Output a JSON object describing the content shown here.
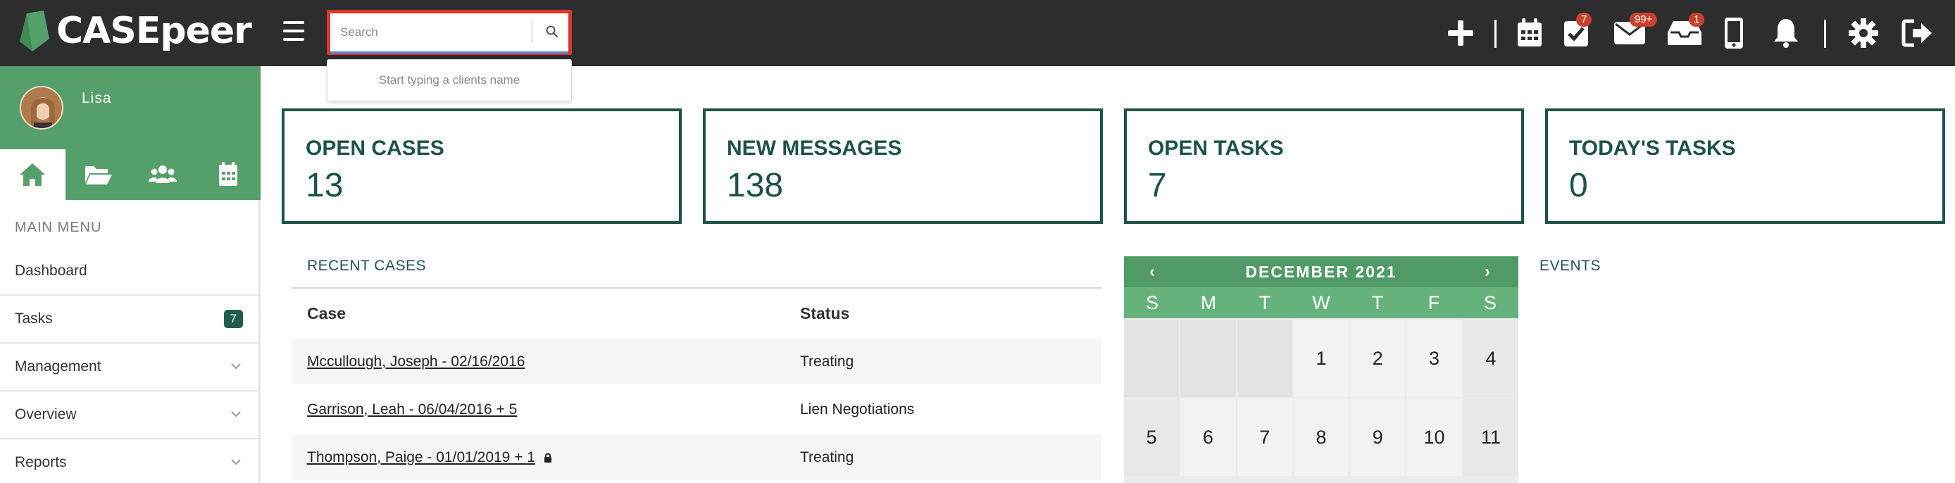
{
  "brand": {
    "name": "CASEpeer"
  },
  "search": {
    "placeholder": "Search",
    "hint": "Start typing a clients name"
  },
  "topbar": {
    "tasks_badge": "7",
    "messages_badge": "99+",
    "inbox_badge": "1"
  },
  "user": {
    "name": "Lisa"
  },
  "sidebar": {
    "menu_label": "MAIN MENU",
    "items": [
      {
        "label": "Dashboard"
      },
      {
        "label": "Tasks",
        "count": "7"
      },
      {
        "label": "Management"
      },
      {
        "label": "Overview"
      },
      {
        "label": "Reports"
      }
    ]
  },
  "stats": [
    {
      "label": "OPEN CASES",
      "value": "13"
    },
    {
      "label": "NEW MESSAGES",
      "value": "138"
    },
    {
      "label": "OPEN TASKS",
      "value": "7"
    },
    {
      "label": "TODAY'S TASKS",
      "value": "0"
    }
  ],
  "recent_cases": {
    "title": "RECENT CASES",
    "headers": {
      "case": "Case",
      "status": "Status"
    },
    "rows": [
      {
        "case": "Mccullough, Joseph - 02/16/2016",
        "status": "Treating"
      },
      {
        "case": "Garrison, Leah - 06/04/2016 + 5",
        "status": "Lien Negotiations"
      },
      {
        "case": "Thompson, Paige - 01/01/2019 + 1",
        "status": "Treating",
        "locked": true
      }
    ]
  },
  "calendar": {
    "title": "DECEMBER 2021",
    "prev": "‹",
    "next": "›",
    "days_of_week": [
      "S",
      "M",
      "T",
      "W",
      "T",
      "F",
      "S"
    ],
    "week1": [
      "",
      "",
      "",
      "1",
      "2",
      "3",
      "4"
    ],
    "week2": [
      "5",
      "6",
      "7",
      "8",
      "9",
      "10",
      "11"
    ]
  },
  "events": {
    "title": "EVENTS"
  },
  "colors": {
    "brand_green": "#55a06a",
    "dark_teal": "#1d5347",
    "topbar": "#2d2d2d",
    "badge_red": "#c8412e",
    "search_highlight": "#d9372b"
  }
}
